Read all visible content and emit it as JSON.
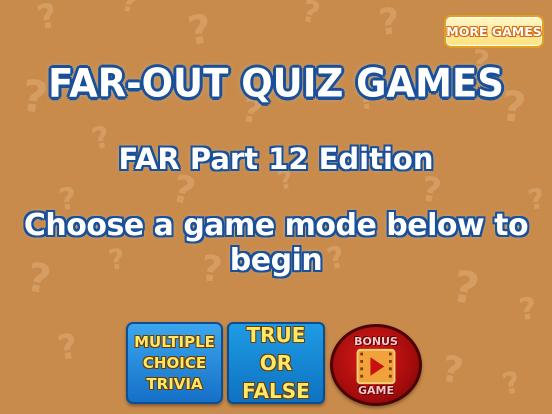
{
  "header": {
    "title": "FAR-OUT QUIZ GAMES",
    "subtitle": "FAR Part 12 Edition",
    "instruction": "Choose a game mode below to begin"
  },
  "more_games_label": "MORE GAMES",
  "modes": {
    "multiple_choice": {
      "line1": "MULTIPLE",
      "line2": "CHOICE",
      "line3": "TRIVIA"
    },
    "true_false": {
      "line1": "TRUE OR",
      "line2": "FALSE"
    },
    "bonus": {
      "top": "BONUS",
      "bottom": "GAME",
      "icon": "play-icon"
    }
  },
  "colors": {
    "background": "#c98b4c",
    "pattern": "#d9a468",
    "title_outline": "#1a4f9a",
    "button_text": "#ffe86a"
  }
}
